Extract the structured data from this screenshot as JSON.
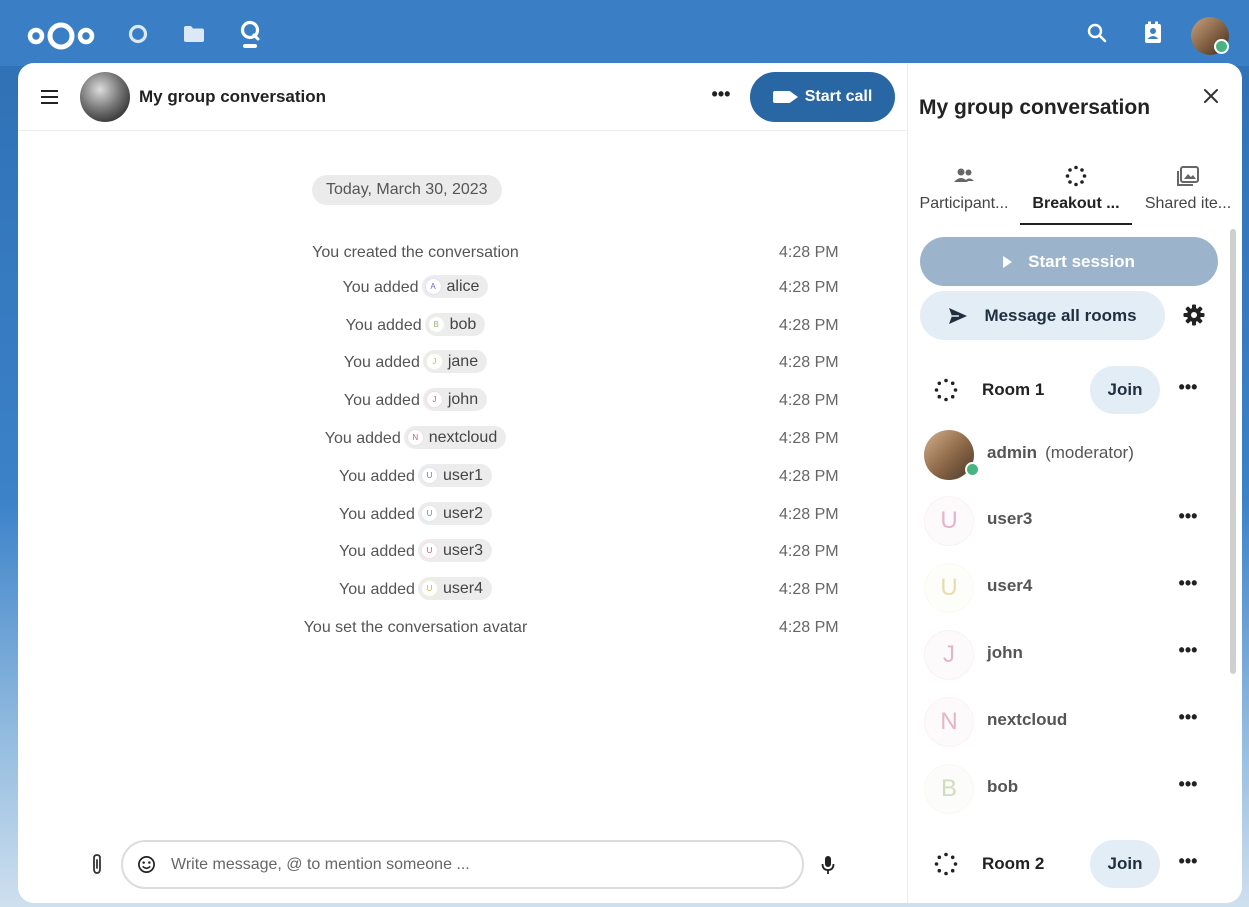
{
  "topbar": {
    "apps": [
      {
        "icon": "dashboard-circle-icon"
      },
      {
        "icon": "files-folder-icon"
      },
      {
        "icon": "talk-icon"
      }
    ],
    "right_icons": [
      "search-icon",
      "contacts-icon"
    ],
    "brand_color": "#3a7fc5"
  },
  "chat": {
    "title": "My group conversation",
    "more_label": "•••",
    "call_label": "Start call",
    "date_separator": "Today, March 30, 2023",
    "messages": [
      {
        "prefix": "You created the conversation",
        "time": "4:28 PM"
      },
      {
        "prefix": "You added",
        "mention": "alice",
        "initial": "A",
        "color": "#7b5fc9",
        "time": "4:28 PM"
      },
      {
        "prefix": "You added",
        "mention": "bob",
        "initial": "B",
        "color": "#9ab36b",
        "time": "4:28 PM"
      },
      {
        "prefix": "You added",
        "mention": "jane",
        "initial": "J",
        "color": "#b8c46e",
        "time": "4:28 PM"
      },
      {
        "prefix": "You added",
        "mention": "john",
        "initial": "J",
        "color": "#c25c8a",
        "time": "4:28 PM"
      },
      {
        "prefix": "You added",
        "mention": "nextcloud",
        "initial": "N",
        "color": "#c85a7a",
        "time": "4:28 PM"
      },
      {
        "prefix": "You added",
        "mention": "user1",
        "initial": "U",
        "color": "#4f86c9",
        "time": "4:28 PM"
      },
      {
        "prefix": "You added",
        "mention": "user2",
        "initial": "U",
        "color": "#4a9bc4",
        "time": "4:28 PM"
      },
      {
        "prefix": "You added",
        "mention": "user3",
        "initial": "U",
        "color": "#c75a87",
        "time": "4:28 PM"
      },
      {
        "prefix": "You added",
        "mention": "user4",
        "initial": "U",
        "color": "#d1b14b",
        "time": "4:28 PM"
      },
      {
        "prefix": "You set the conversation avatar",
        "time": "4:28 PM"
      }
    ],
    "composer_placeholder": "Write message, @ to mention someone ..."
  },
  "sidebar": {
    "title": "My group conversation",
    "tabs": [
      {
        "label": "Participant...",
        "icon": "participants-icon",
        "active": false
      },
      {
        "label": "Breakout ...",
        "icon": "breakout-rooms-icon",
        "active": true
      },
      {
        "label": "Shared ite...",
        "icon": "shared-items-icon",
        "active": false
      }
    ],
    "start_session_label": "Start session",
    "message_all_label": "Message all rooms",
    "rooms": [
      {
        "name": "Room 1",
        "join_label": "Join"
      },
      {
        "name": "Room 2",
        "join_label": "Join"
      }
    ],
    "participants": [
      {
        "name": "admin",
        "role": "(moderator)",
        "initial": "",
        "color": "",
        "online": true
      },
      {
        "name": "user3",
        "initial": "U",
        "color": "#c75a87"
      },
      {
        "name": "user4",
        "initial": "U",
        "color": "#d1b14b"
      },
      {
        "name": "john",
        "initial": "J",
        "color": "#c25c8a"
      },
      {
        "name": "nextcloud",
        "initial": "N",
        "color": "#c85a7a"
      },
      {
        "name": "bob",
        "initial": "B",
        "color": "#9ab36b"
      }
    ],
    "dots_label": "•••"
  }
}
